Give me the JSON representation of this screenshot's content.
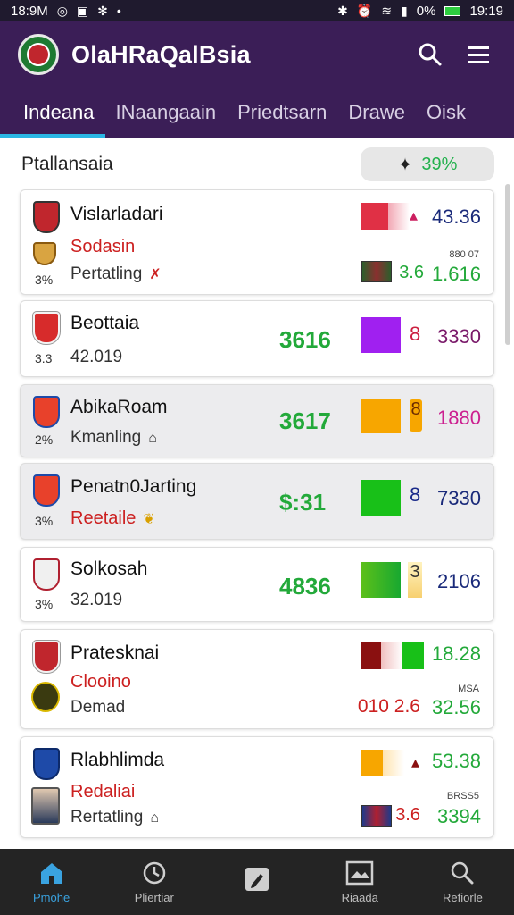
{
  "status_bar": {
    "left_time": "18:9M",
    "right_battery_pct": "0%",
    "right_time": "19:19"
  },
  "app": {
    "title": "OlaHRaQalBsia"
  },
  "tabs": [
    {
      "label": "Indeana",
      "active": true
    },
    {
      "label": "INaangaain",
      "active": false
    },
    {
      "label": "Priedtsarn",
      "active": false
    },
    {
      "label": "Drawe",
      "active": false
    },
    {
      "label": "Oisk",
      "active": false
    }
  ],
  "section": {
    "title": "Ptallansaia",
    "pill_value": "39%"
  },
  "rows": [
    {
      "name": "Vislarladari",
      "sub1": "Sodasin",
      "sub2": "Pertatling",
      "small": "3%",
      "right_top": "43.36",
      "right_tiny": "880 07",
      "right_mid": "3.6",
      "right_bottom": "1.616"
    },
    {
      "name": "Beottaia",
      "sub": "42.019",
      "small": "3.3",
      "price": "3616",
      "digit": "8",
      "right": "3330"
    },
    {
      "name": "AbikaRoam",
      "sub": "Kmanling",
      "small": "2%",
      "price": "3617",
      "digit": "8",
      "right": "1880"
    },
    {
      "name": "Penatn0Jarting",
      "sub": "Reetaile",
      "small": "3%",
      "price": "$:31",
      "digit": "8",
      "right": "7330"
    },
    {
      "name": "Solkosah",
      "sub": "32.019",
      "small": "3%",
      "price": "4836",
      "digit": "3",
      "right": "2106"
    },
    {
      "name": "Pratesknai",
      "sub1": "Clooino",
      "sub2": "Demad",
      "right_top": "18.28",
      "right_tiny": "MSA",
      "right_mid": "010 2.6",
      "right_bottom": "32.56"
    },
    {
      "name": "Rlabhlimda",
      "sub1": "Redaliai",
      "sub2": "Rertatling",
      "right_top": "53.38",
      "right_tiny": "BRSS5",
      "right_mid": "3.6",
      "right_bottom": "3394"
    }
  ],
  "bottom_nav": [
    {
      "label": "Pmohe",
      "icon": "home-icon",
      "active": true
    },
    {
      "label": "Pliertiar",
      "icon": "clock-icon",
      "active": false
    },
    {
      "label": "",
      "icon": "edit-icon",
      "active": false
    },
    {
      "label": "Riaada",
      "icon": "picture-icon",
      "active": false
    },
    {
      "label": "Refiorle",
      "icon": "search-icon",
      "active": false
    }
  ],
  "colors": {
    "app_bar": "#3b1e57",
    "accent_tab": "#2bb7e4",
    "green": "#23a93a",
    "red": "#cc2020"
  }
}
